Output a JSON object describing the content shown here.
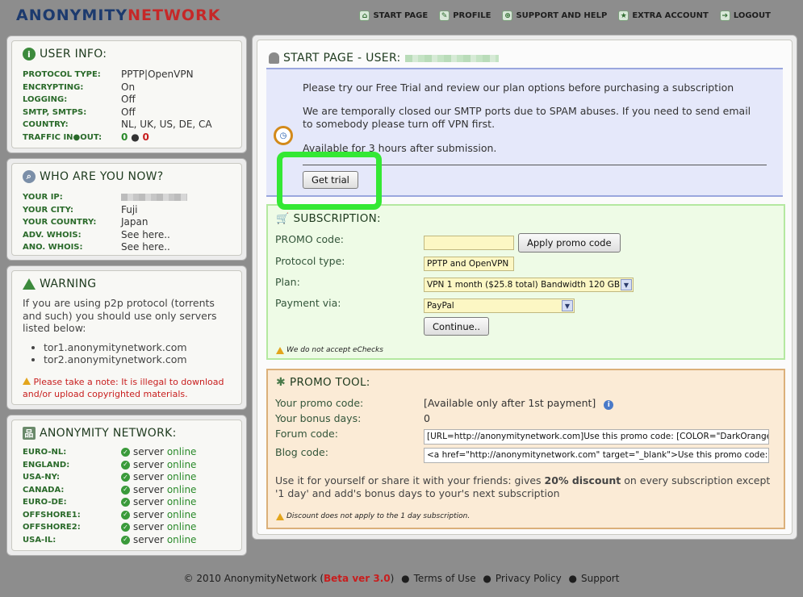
{
  "brand": {
    "part1": "ANONYMITY",
    "part2": "NETWORK"
  },
  "nav": [
    {
      "label": "START PAGE",
      "icon": "home-icon"
    },
    {
      "label": "PROFILE",
      "icon": "pin-icon"
    },
    {
      "label": "SUPPORT AND HELP",
      "icon": "lifebuoy-icon"
    },
    {
      "label": "EXTRA ACCOUNT",
      "icon": "star-icon"
    },
    {
      "label": "LOGOUT",
      "icon": "exit-icon"
    }
  ],
  "user_info": {
    "title": "USER INFO:",
    "rows": [
      {
        "k": "PROTOCOL TYPE:",
        "v": "PPTP|OpenVPN"
      },
      {
        "k": "ENCRYPTING:",
        "v": "On"
      },
      {
        "k": "LOGGING:",
        "v": "Off"
      },
      {
        "k": "SMTP, SMTPS:",
        "v": "Off"
      },
      {
        "k": "COUNTRY:",
        "v": "NL, UK, US, DE, CA"
      },
      {
        "k": "TRAFFIC IN●OUT:",
        "v_in": "0",
        "sep": "●",
        "v_out": "0"
      }
    ]
  },
  "who": {
    "title": "WHO ARE YOU NOW?",
    "rows": [
      {
        "k": "YOUR IP:"
      },
      {
        "k": "YOUR CITY:",
        "v": "Fuji"
      },
      {
        "k": "YOUR COUNTRY:",
        "v": "Japan"
      },
      {
        "k": "ADV. WHOIS:",
        "v": "See here.."
      },
      {
        "k": "ANO. WHOIS:",
        "v": "See here.."
      }
    ]
  },
  "warning": {
    "title": "WARNING",
    "text": "If you are using p2p protocol (torrents and such) you should use only servers listed below:",
    "servers": [
      "tor1.anonymitynetwork.com",
      "tor2.anonymitynetwork.com"
    ],
    "note": "Please take a note: It is illegal to download and/or upload copyrighted materials."
  },
  "network": {
    "title": "ANONYMITY NETWORK:",
    "rows": [
      {
        "k": "EURO-NL:",
        "server": "server",
        "status": "online"
      },
      {
        "k": "ENGLAND:",
        "server": "server",
        "status": "online"
      },
      {
        "k": "USA-NY:",
        "server": "server",
        "status": "online"
      },
      {
        "k": "CANADA:",
        "server": "server",
        "status": "online"
      },
      {
        "k": "EURO-DE:",
        "server": "server",
        "status": "online"
      },
      {
        "k": "OFFSHORE1:",
        "server": "server",
        "status": "online"
      },
      {
        "k": "OFFSHORE2:",
        "server": "server",
        "status": "online"
      },
      {
        "k": "USA-IL:",
        "server": "server",
        "status": "online"
      }
    ]
  },
  "main": {
    "title": "START PAGE - USER:",
    "trial": {
      "line1": "Please try our Free Trial and review our plan options before purchasing a subscription",
      "line2": "We are temporally closed our SMTP ports due to SPAM abuses. If you need to send email to somebody please turn off VPN first.",
      "line3": "Available for 3 hours after submission.",
      "button": "Get trial"
    },
    "subscription": {
      "title": "SUBSCRIPTION:",
      "promo_label": "PROMO code:",
      "promo_value": "",
      "apply_button": "Apply promo code",
      "protocol_label": "Protocol type:",
      "protocol_value": "PPTP and OpenVPN",
      "plan_label": "Plan:",
      "plan_value": "VPN 1 month ($25.8 total) Bandwidth 120 GB",
      "payment_label": "Payment via:",
      "payment_value": "PayPal",
      "continue_button": "Continue..",
      "note": "We do not accept eChecks"
    },
    "promo": {
      "title": "PROMO TOOL:",
      "code_label": "Your promo code:",
      "code_value": "[Available only after 1st payment]",
      "days_label": "Your bonus days:",
      "days_value": "0",
      "forum_label": "Forum code:",
      "forum_value": "[URL=http://anonymitynetwork.com]Use this promo code: [COLOR=\"DarkOrange\"][",
      "blog_label": "Blog code:",
      "blog_value": "<a href=\"http://anonymitynetwork.com\" target=\"_blank\">Use this promo code: <b>",
      "desc_pre": "Use it for yourself or share it with your friends: gives ",
      "desc_bold": "20% discount",
      "desc_post": " on every subscription except '1 day' and add's bonus days to your's next subscription",
      "note": "Discount does not apply to the 1 day subscription."
    }
  },
  "footer": {
    "copyright": "© 2010 AnonymityNetwork (",
    "beta": "Beta ver 3.0",
    "close": ")",
    "links": [
      "Terms of Use",
      "Privacy Policy",
      "Support"
    ]
  }
}
